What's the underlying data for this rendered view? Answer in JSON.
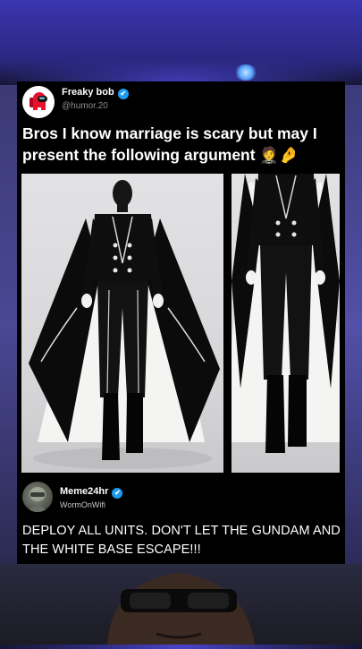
{
  "post": {
    "author_name": "Freaky bob",
    "author_handle": "@humor.20",
    "verified_mark": "✔",
    "text": "Bros I know marriage is scary but may I present the following argument 🤵🤌"
  },
  "reply": {
    "author_name": "Meme24hr",
    "author_handle": "WormOnWifi",
    "verified_mark": "✔",
    "text": "DEPLOY ALL UNITS. DON'T LET THE GUNDAM AND THE WHITE BASE ESCAPE!!!"
  },
  "colors": {
    "card_background": "#000000",
    "verified_blue": "#1d9bf0",
    "handle_gray": "#8a8d91",
    "backdrop_purple": "#3a35b0"
  },
  "icons": [
    "among-us-avatar-icon",
    "verified-badge-icon",
    "lamp-glow",
    "reply-avatar-icon"
  ]
}
